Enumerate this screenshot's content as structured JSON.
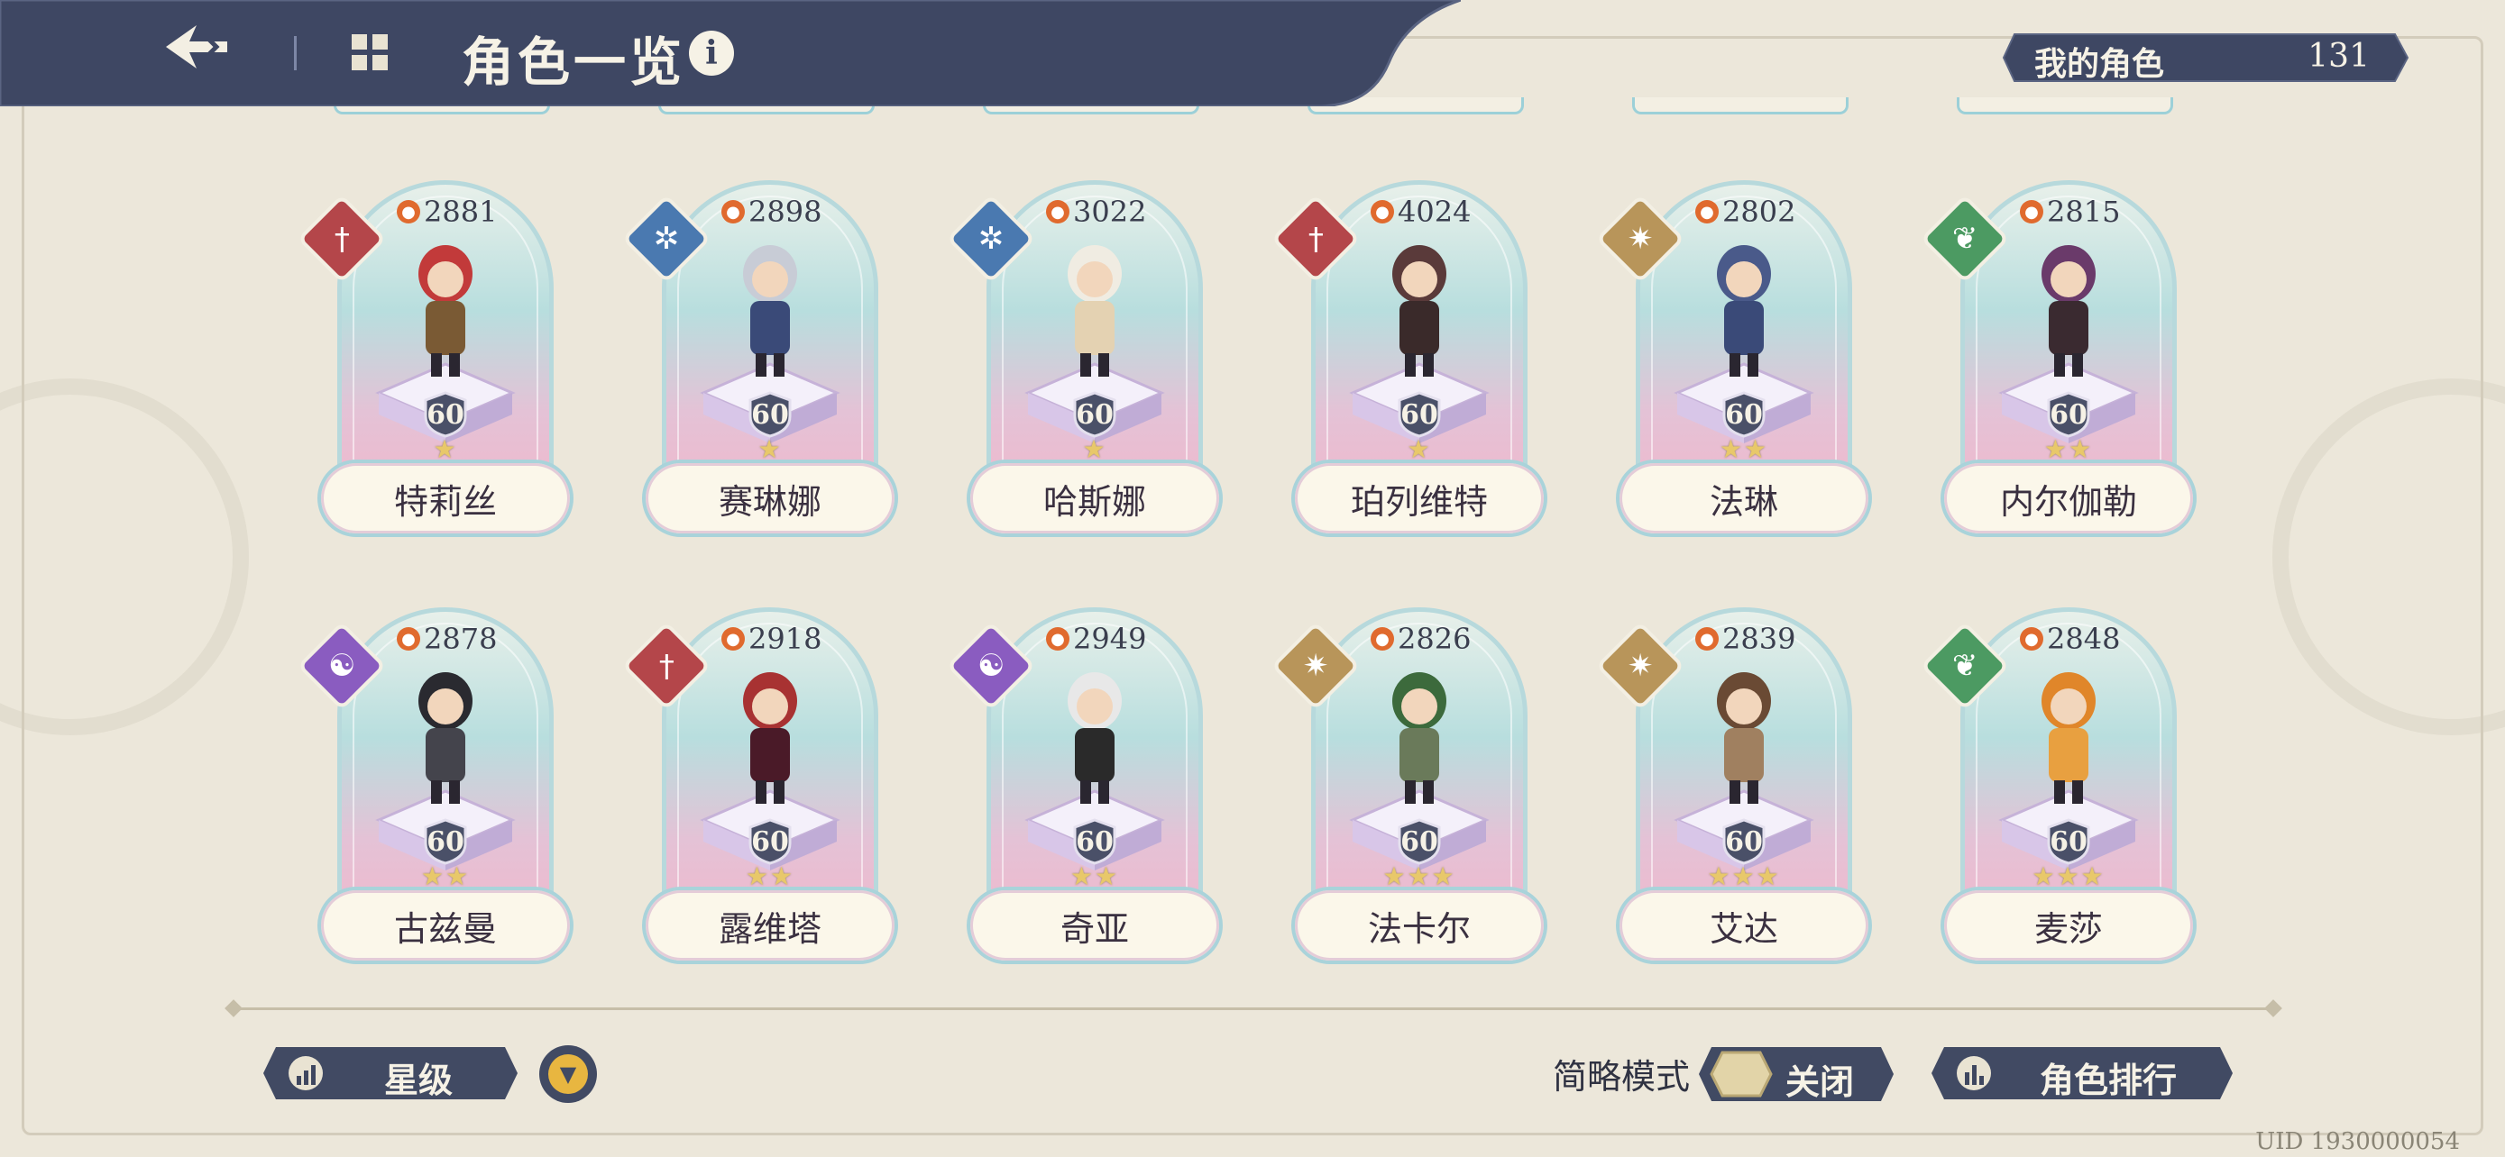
{
  "header": {
    "title": "角色一览",
    "info_icon": "i",
    "my_characters_label": "我的角色",
    "my_characters_count": "131"
  },
  "colors": {
    "header_bg": "#3e4763",
    "background": "#ece7da",
    "fire": "#b4464a",
    "ice": "#4a79b0",
    "light": "#b8955a",
    "wind": "#4c9a62",
    "dark": "#8a5cc0"
  },
  "characters": [
    {
      "name": "特莉丝",
      "power": "2881",
      "level": "60",
      "stars": "★",
      "element": "fire-element-icon",
      "element_color": "#b4464a",
      "element_glyph": "†"
    },
    {
      "name": "赛琳娜",
      "power": "2898",
      "level": "60",
      "stars": "★",
      "element": "ice-element-icon",
      "element_color": "#4a79b0",
      "element_glyph": "✲"
    },
    {
      "name": "哈斯娜",
      "power": "3022",
      "level": "60",
      "stars": "★",
      "element": "ice-element-icon",
      "element_color": "#4a79b0",
      "element_glyph": "✲"
    },
    {
      "name": "珀列维特",
      "power": "4024",
      "level": "60",
      "stars": "★",
      "element": "fire-element-icon",
      "element_color": "#b4464a",
      "element_glyph": "†"
    },
    {
      "name": "法琳",
      "power": "2802",
      "level": "60",
      "stars": "★★",
      "element": "light-element-icon",
      "element_color": "#b8955a",
      "element_glyph": "✷"
    },
    {
      "name": "内尔伽勒",
      "power": "2815",
      "level": "60",
      "stars": "★★",
      "element": "wind-element-icon",
      "element_color": "#4c9a62",
      "element_glyph": "❦"
    },
    {
      "name": "古兹曼",
      "power": "2878",
      "level": "60",
      "stars": "★★",
      "element": "dark-element-icon",
      "element_color": "#8a5cc0",
      "element_glyph": "☯"
    },
    {
      "name": "露维塔",
      "power": "2918",
      "level": "60",
      "stars": "★★",
      "element": "fire-element-icon",
      "element_color": "#b4464a",
      "element_glyph": "†"
    },
    {
      "name": "奇亚",
      "power": "2949",
      "level": "60",
      "stars": "★★",
      "element": "dark-element-icon",
      "element_color": "#8a5cc0",
      "element_glyph": "☯"
    },
    {
      "name": "法卡尔",
      "power": "2826",
      "level": "60",
      "stars": "★★★",
      "element": "light-element-icon",
      "element_color": "#b8955a",
      "element_glyph": "✷"
    },
    {
      "name": "艾达",
      "power": "2839",
      "level": "60",
      "stars": "★★★",
      "element": "light-element-icon",
      "element_color": "#b8955a",
      "element_glyph": "✷"
    },
    {
      "name": "麦莎",
      "power": "2848",
      "level": "60",
      "stars": "★★★",
      "element": "wind-element-icon",
      "element_color": "#4c9a62",
      "element_glyph": "❦"
    }
  ],
  "footer": {
    "sort_label": "星级",
    "brief_mode_label": "简略模式",
    "brief_mode_value": "关闭",
    "ranking_label": "角色排行",
    "uid": "UID 1930000054"
  }
}
